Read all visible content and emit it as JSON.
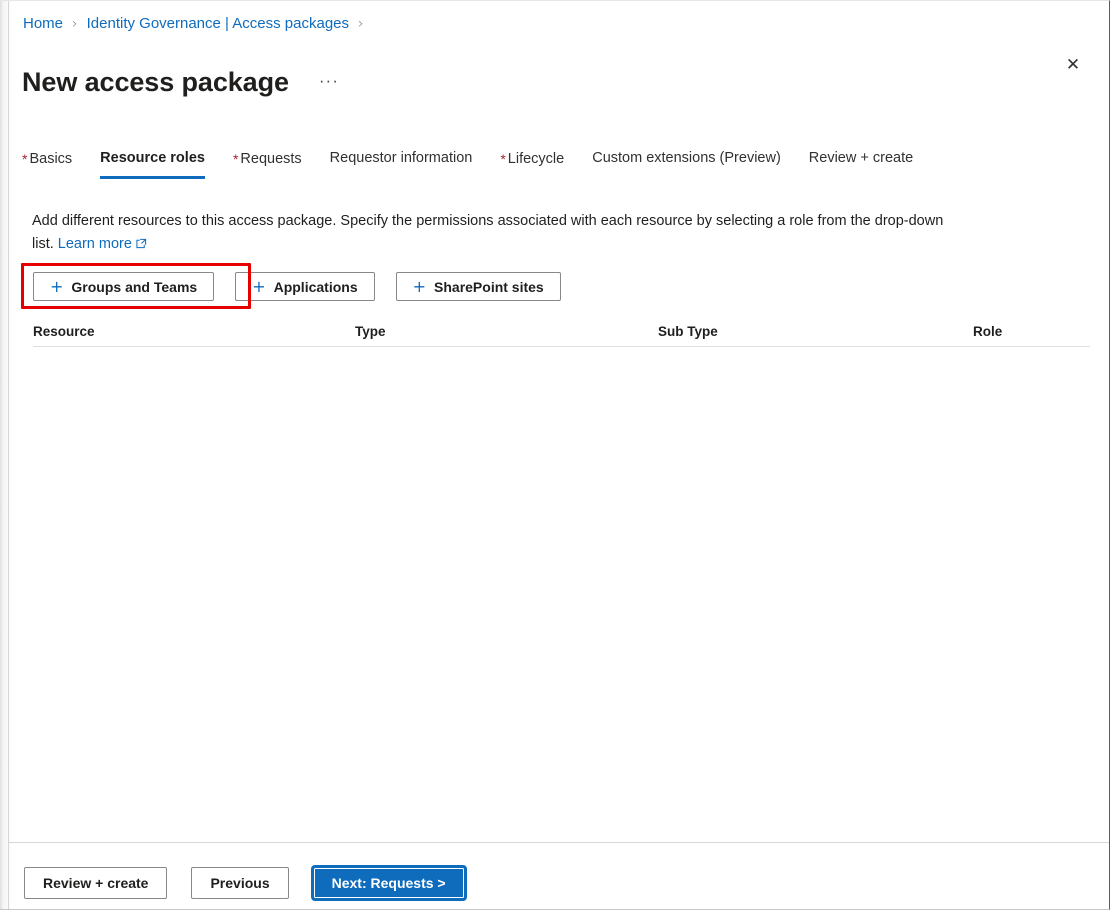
{
  "breadcrumb": {
    "items": [
      {
        "label": "Home"
      },
      {
        "label": "Identity Governance | Access packages"
      }
    ],
    "separator": "›"
  },
  "header": {
    "title": "New access package",
    "more_label": "···",
    "close_label": "✕"
  },
  "tabs": [
    {
      "label": "Basics",
      "required": true,
      "active": false
    },
    {
      "label": "Resource roles",
      "required": false,
      "active": true
    },
    {
      "label": "Requests",
      "required": true,
      "active": false
    },
    {
      "label": "Requestor information",
      "required": false,
      "active": false
    },
    {
      "label": "Lifecycle",
      "required": true,
      "active": false
    },
    {
      "label": "Custom extensions (Preview)",
      "required": false,
      "active": false
    },
    {
      "label": "Review + create",
      "required": false,
      "active": false
    }
  ],
  "description": {
    "text": "Add different resources to this access package. Specify the permissions associated with each resource by selecting a role from the drop-down list.",
    "link_label": "Learn more"
  },
  "add_buttons": [
    {
      "label": "Groups and Teams",
      "icon": "plus-icon",
      "highlighted": true
    },
    {
      "label": "Applications",
      "icon": "plus-icon",
      "highlighted": false
    },
    {
      "label": "SharePoint sites",
      "icon": "plus-icon",
      "highlighted": false
    }
  ],
  "table": {
    "columns": [
      "Resource",
      "Type",
      "Sub Type",
      "Role"
    ],
    "rows": []
  },
  "footer": {
    "review_label": "Review + create",
    "previous_label": "Previous",
    "next_label": "Next: Requests >"
  },
  "colors": {
    "accent_blue": "#0f6cbd",
    "required_red": "#a4262c",
    "highlight_red": "#e60000",
    "text_primary": "#201f1e",
    "border": "#8a8886"
  }
}
